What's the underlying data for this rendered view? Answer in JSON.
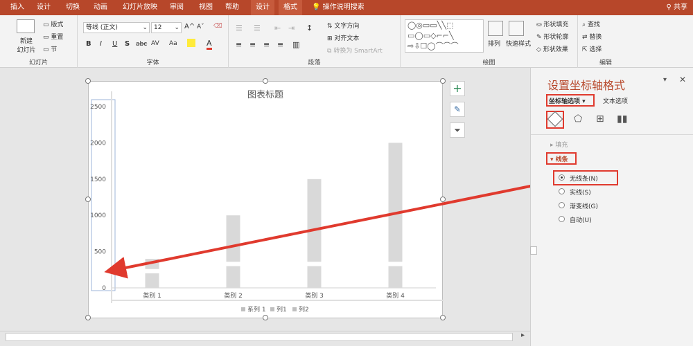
{
  "tabs": [
    {
      "label": "插入",
      "active": false
    },
    {
      "label": "设计",
      "active": false
    },
    {
      "label": "切换",
      "active": false
    },
    {
      "label": "动画",
      "active": false
    },
    {
      "label": "幻灯片放映",
      "active": false
    },
    {
      "label": "审阅",
      "active": false
    },
    {
      "label": "视图",
      "active": false
    },
    {
      "label": "帮助",
      "active": false
    },
    {
      "label": "设计",
      "active": true
    },
    {
      "label": "格式",
      "active": false
    }
  ],
  "tell_me": "操作说明搜索",
  "share": "共享",
  "ribbon": {
    "slides": {
      "name": "幻灯片",
      "new_slide": "新建",
      "new_slide2": "幻灯片",
      "layout": "版式",
      "reset": "重置",
      "section": "节"
    },
    "font": {
      "name": "字体",
      "font_family": "等线 (正文)",
      "font_size": "12",
      "bold": "B",
      "italic": "I",
      "underline": "U",
      "shadow": "S",
      "strike": "abc",
      "spacing": "AV",
      "case": "Aa",
      "grow": "A",
      "shrink": "A"
    },
    "paragraph": {
      "name": "段落",
      "text_direction": "文字方向",
      "align_text": "对齐文本",
      "smartart": "转换为 SmartArt"
    },
    "drawing": {
      "name": "绘图",
      "arrange": "排列",
      "quick_styles": "快速样式",
      "fill": "形状填充",
      "outline": "形状轮廓",
      "effects": "形状效果"
    },
    "editing": {
      "name": "编辑",
      "find": "查找",
      "replace": "替换",
      "select": "选择"
    }
  },
  "chart_data": {
    "type": "bar",
    "title": "图表标题",
    "categories": [
      "类别 1",
      "类别 2",
      "类别 3",
      "类别 4"
    ],
    "series": [
      {
        "name": "系列 1",
        "values": [
          200,
          700,
          1200,
          1700
        ]
      },
      {
        "name": "列1",
        "values": [
          200,
          300,
          300,
          300
        ]
      },
      {
        "name": "列2",
        "values": [
          0,
          0,
          0,
          0
        ]
      }
    ],
    "yticks": [
      "0",
      "500",
      "1000",
      "1500",
      "2000",
      "2500"
    ],
    "ylim": [
      0,
      2500
    ],
    "legend_position": "bottom",
    "colors": {
      "bar": "#d9d9d9",
      "accent": "#e03a2e"
    }
  },
  "panel": {
    "title": "设置坐标轴格式",
    "tab_axis": "坐标轴选项",
    "tab_text": "文本选项",
    "fill_section": "填充",
    "line_section": "线条",
    "options": [
      "无线条(N)",
      "实线(S)",
      "渐变线(G)",
      "自动(U)"
    ],
    "selected_option": 0
  }
}
